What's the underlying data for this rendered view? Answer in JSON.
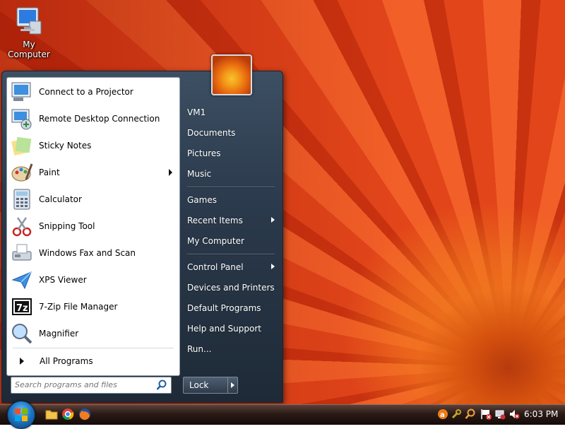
{
  "desktop": {
    "icons": [
      {
        "label": "My Computer",
        "icon": "computer-icon"
      }
    ]
  },
  "start_menu": {
    "programs": [
      {
        "label": "Connect to a Projector",
        "icon": "projector-icon",
        "has_submenu": false
      },
      {
        "label": "Remote Desktop Connection",
        "icon": "remote-desktop-icon",
        "has_submenu": false
      },
      {
        "label": "Sticky Notes",
        "icon": "sticky-notes-icon",
        "has_submenu": false
      },
      {
        "label": "Paint",
        "icon": "paint-icon",
        "has_submenu": true
      },
      {
        "label": "Calculator",
        "icon": "calculator-icon",
        "has_submenu": false
      },
      {
        "label": "Snipping Tool",
        "icon": "scissors-icon",
        "has_submenu": false
      },
      {
        "label": "Windows Fax and Scan",
        "icon": "fax-icon",
        "has_submenu": false
      },
      {
        "label": "XPS Viewer",
        "icon": "xps-icon",
        "has_submenu": false
      },
      {
        "label": "7-Zip File Manager",
        "icon": "7zip-icon",
        "has_submenu": false
      },
      {
        "label": "Magnifier",
        "icon": "magnifier-icon",
        "has_submenu": false
      }
    ],
    "all_programs": "All Programs",
    "search_placeholder": "Search programs and files",
    "places": [
      {
        "label": "VM1",
        "has_submenu": false
      },
      {
        "label": "Documents",
        "has_submenu": false
      },
      {
        "label": "Pictures",
        "has_submenu": false
      },
      {
        "label": "Music",
        "has_submenu": false
      },
      {
        "label": "Games",
        "has_submenu": false
      },
      {
        "label": "Recent Items",
        "has_submenu": true
      },
      {
        "label": "My Computer",
        "has_submenu": false
      },
      {
        "label": "Control Panel",
        "has_submenu": true
      },
      {
        "label": "Devices and Printers",
        "has_submenu": false
      },
      {
        "label": "Default Programs",
        "has_submenu": false
      },
      {
        "label": "Help and Support",
        "has_submenu": false
      },
      {
        "label": "Run...",
        "has_submenu": false
      }
    ],
    "lock_label": "Lock"
  },
  "taskbar": {
    "pinned": [
      "folder-icon",
      "chrome-icon",
      "firefox-icon"
    ],
    "tray": [
      "avast-icon",
      "tools-icon",
      "search-icon",
      "flag-icon",
      "network-icon",
      "volume-icon"
    ],
    "clock": "6:03 PM"
  }
}
